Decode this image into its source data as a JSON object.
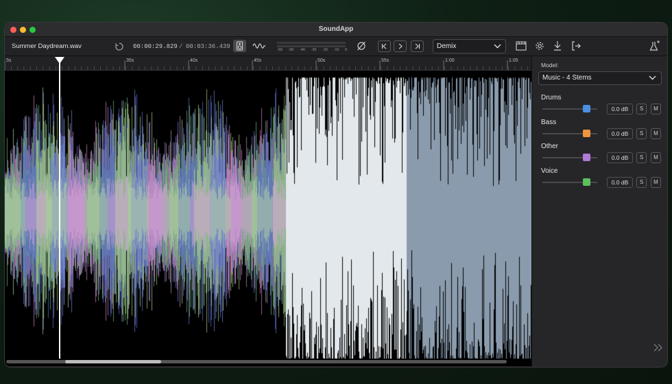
{
  "window": {
    "title": "SoundApp"
  },
  "toolbar": {
    "filename": "Summer Daydream.wav",
    "current_time": "00:00:29.829",
    "separator": "/",
    "total_time": "00:03:36.439",
    "meter_scale": [
      "-60",
      "-50",
      "-40",
      "-30",
      "-20",
      "-10",
      "0"
    ],
    "mode": "Demix",
    "prev_symbol": "|<",
    "play_symbol": ">",
    "next_symbol": ">|"
  },
  "ruler": {
    "tick_labels": [
      "5s",
      "35s",
      "40s",
      "45s",
      "50s",
      "55s",
      "1:00",
      "1:05"
    ]
  },
  "panel": {
    "model_label": "Model:",
    "model_value": "Music - 4 Stems",
    "stems": [
      {
        "name": "Drums",
        "db": "0.0 dB",
        "solo": "S",
        "mute": "M",
        "color": "#4a8fe0"
      },
      {
        "name": "Bass",
        "db": "0.0 dB",
        "solo": "S",
        "mute": "M",
        "color": "#f0943e"
      },
      {
        "name": "Other",
        "db": "0.0 dB",
        "solo": "S",
        "mute": "M",
        "color": "#b07ad6"
      },
      {
        "name": "Voice",
        "db": "0.0 dB",
        "solo": "S",
        "mute": "M",
        "color": "#5cc05c"
      }
    ]
  },
  "playback": {
    "progress_fraction": 0.137
  },
  "icons": [
    "refresh-icon",
    "speaker-icon",
    "waveform-icon",
    "phase-invert-icon",
    "clapperboard-icon",
    "gear-icon",
    "download-icon",
    "export-icon",
    "magic-flask-icon",
    "expand-chevrons-icon"
  ]
}
